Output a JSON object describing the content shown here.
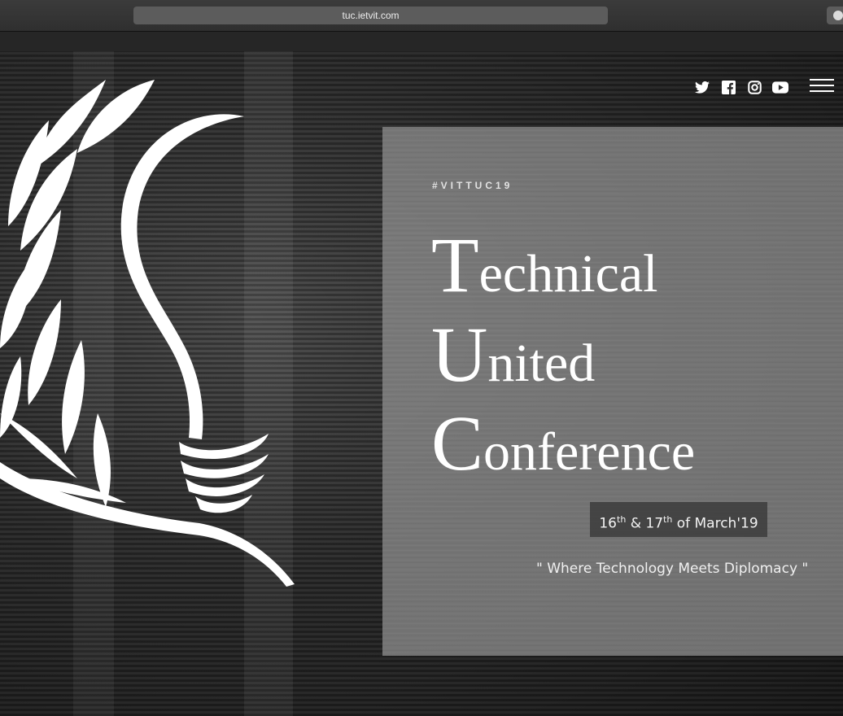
{
  "browser": {
    "url": "tuc.ietvit.com"
  },
  "header": {
    "social_icons": [
      "twitter-icon",
      "facebook-icon",
      "instagram-icon",
      "youtube-icon"
    ],
    "menu_icon": "hamburger-menu-icon"
  },
  "hero": {
    "hashtag": "#VITTUC19",
    "title": [
      {
        "initial": "T",
        "rest": "echnical"
      },
      {
        "initial": "U",
        "rest": "nited"
      },
      {
        "initial": "C",
        "rest": "onference"
      }
    ],
    "date": {
      "day1": "16",
      "sup1": "th",
      "joiner": " & ",
      "day2": "17",
      "sup2": "th",
      "suffix": " of March'19"
    },
    "tagline": "\" Where Technology Meets Diplomacy \""
  },
  "colors": {
    "card_bg": "#969696",
    "badge_bg": "#3c3c3c",
    "text": "#ffffff"
  }
}
